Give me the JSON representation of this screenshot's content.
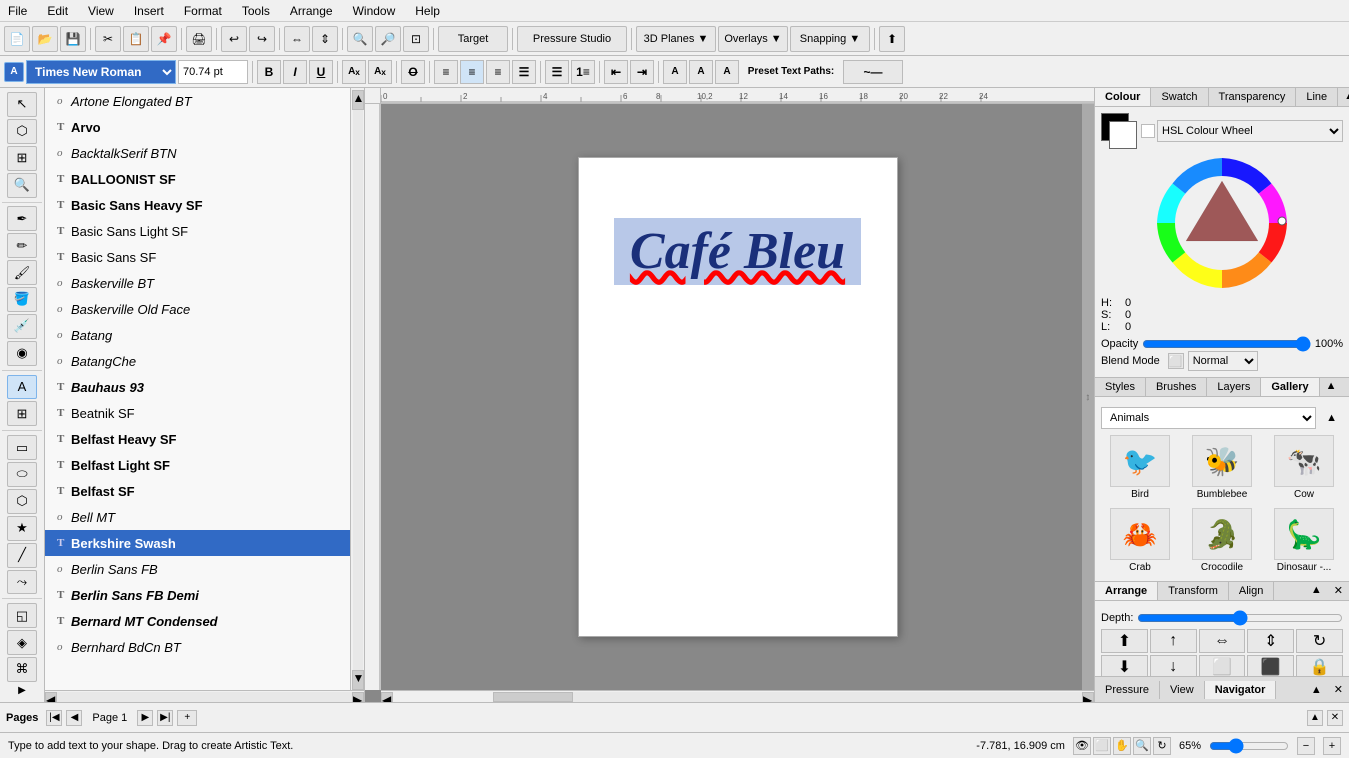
{
  "menubar": {
    "items": [
      "File",
      "Edit",
      "View",
      "Insert",
      "Format",
      "Tools",
      "Arrange",
      "Window",
      "Help"
    ]
  },
  "toolbar": {
    "font_name": "Times New Roman",
    "font_size": "70.74 pt",
    "bold_label": "B",
    "italic_label": "I",
    "underline_label": "U",
    "target_label": "Target",
    "pressure_studio_label": "Pressure Studio",
    "planes_label": "3D Planes ▼",
    "overlays_label": "Overlays ▼",
    "snapping_label": "Snapping ▼"
  },
  "font_list": {
    "fonts": [
      {
        "name": "Artone Elongated BT",
        "style": "italic"
      },
      {
        "name": "Arvo",
        "style": "bold"
      },
      {
        "name": "BacktalkSerif BTN",
        "style": "italic"
      },
      {
        "name": "BALLOONIST SF",
        "style": "bold"
      },
      {
        "name": "Basic Sans Heavy SF",
        "style": "bold"
      },
      {
        "name": "Basic Sans Light SF",
        "style": "normal"
      },
      {
        "name": "Basic Sans SF",
        "style": "normal"
      },
      {
        "name": "Baskerville BT",
        "style": "italic"
      },
      {
        "name": "Baskerville Old Face",
        "style": "italic"
      },
      {
        "name": "Batang",
        "style": "italic"
      },
      {
        "name": "BatangChe",
        "style": "italic"
      },
      {
        "name": "Bauhaus 93",
        "style": "bold-italic"
      },
      {
        "name": "Beatnik SF",
        "style": "normal"
      },
      {
        "name": "Belfast Heavy SF",
        "style": "bold"
      },
      {
        "name": "Belfast Light SF",
        "style": "bold"
      },
      {
        "name": "Belfast SF",
        "style": "bold"
      },
      {
        "name": "Bell MT",
        "style": "italic"
      },
      {
        "name": "Berkshire Swash",
        "style": "bold",
        "selected": true
      },
      {
        "name": "Berlin Sans FB",
        "style": "italic"
      },
      {
        "name": "Berlin Sans FB Demi",
        "style": "bold-italic"
      },
      {
        "name": "Bernard MT Condensed",
        "style": "bold-italic"
      },
      {
        "name": "Bernhard BdCn BT",
        "style": "italic"
      }
    ]
  },
  "canvas": {
    "text": "Café Bleu",
    "status_text": "Type to add text to your shape. Drag to create Artistic Text.",
    "coordinates": "-7.781, 16.909 cm",
    "zoom": "65%"
  },
  "right_panel": {
    "colour_tab": "Colour",
    "swatch_tab": "Swatch",
    "transparency_tab": "Transparency",
    "line_tab": "Line",
    "hsl_colour_wheel": "HSL Colour Wheel",
    "h_value": "0",
    "s_value": "0",
    "l_value": "0",
    "opacity_label": "Opacity",
    "opacity_value": "100%",
    "blend_mode_label": "Blend Mode",
    "blend_mode_value": "Normal"
  },
  "gallery": {
    "styles_tab": "Styles",
    "brushes_tab": "Brushes",
    "layers_tab": "Layers",
    "gallery_tab": "Gallery",
    "category": "Animals",
    "items": [
      {
        "name": "Bird",
        "emoji": "🐦"
      },
      {
        "name": "Bumblebee",
        "emoji": "🐝"
      },
      {
        "name": "Cow",
        "emoji": "🐄"
      },
      {
        "name": "Crab",
        "emoji": "🦀"
      },
      {
        "name": "Crocodile",
        "emoji": "🐊"
      },
      {
        "name": "Dinosaur -...",
        "emoji": "🦕"
      }
    ]
  },
  "arrange": {
    "arrange_tab": "Arrange",
    "transform_tab": "Transform",
    "align_tab": "Align",
    "depth_label": "Depth:"
  },
  "pages": {
    "tab": "Pages",
    "page_label": "Page 1"
  },
  "right_bottom": {
    "pressure_tab": "Pressure",
    "view_tab": "View",
    "navigator_tab": "Navigator"
  }
}
